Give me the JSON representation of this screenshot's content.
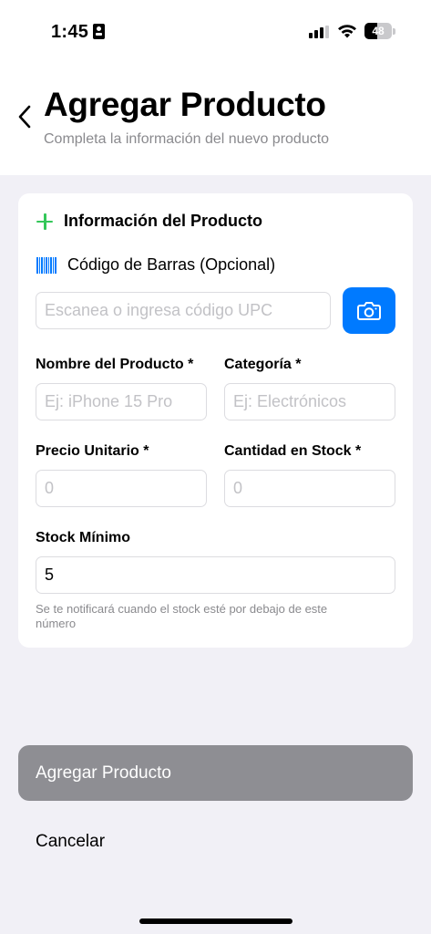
{
  "status_bar": {
    "time": "1:45",
    "battery_level": "48"
  },
  "header": {
    "title": "Agregar Producto",
    "subtitle": "Completa la información del nuevo producto"
  },
  "form": {
    "section_title": "Información del Producto",
    "barcode": {
      "label": "Código de Barras (Opcional)",
      "placeholder": "Escanea o ingresa código UPC"
    },
    "product_name": {
      "label": "Nombre del Producto *",
      "placeholder": "Ej: iPhone 15 Pro"
    },
    "category": {
      "label": "Categoría *",
      "placeholder": "Ej: Electrónicos"
    },
    "unit_price": {
      "label": "Precio Unitario *",
      "placeholder": "0"
    },
    "stock_quantity": {
      "label": "Cantidad en Stock *",
      "placeholder": "0"
    },
    "min_stock": {
      "label": "Stock Mínimo",
      "value": "5",
      "hint": "Se te notificará cuando el stock esté por debajo de este número"
    }
  },
  "actions": {
    "submit_label": "Agregar Producto",
    "cancel_label": "Cancelar"
  },
  "colors": {
    "accent": "#007aff",
    "success": "#34c759",
    "disabled_button": "#8e8e93",
    "background": "#f1f0f6"
  },
  "icons": [
    "id-card-icon",
    "signal-icon",
    "wifi-icon",
    "battery-icon",
    "back-chevron-icon",
    "plus-icon",
    "barcode-icon",
    "camera-icon"
  ]
}
